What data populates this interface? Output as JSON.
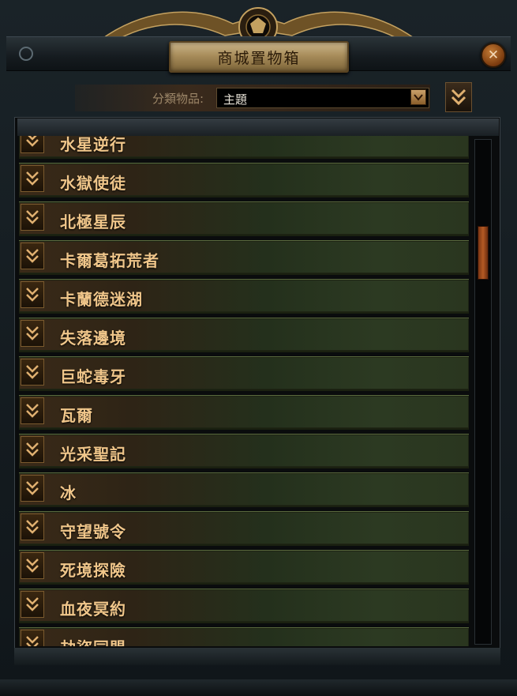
{
  "window": {
    "title": "商城置物箱",
    "close_glyph": "✕"
  },
  "filter": {
    "label": "分類物品:",
    "selected": "主題"
  },
  "items": [
    "水星逆行",
    "水獄使徒",
    "北極星辰",
    "卡爾葛拓荒者",
    "卡蘭德迷湖",
    "失落邊境",
    "巨蛇毒牙",
    "瓦爾",
    "光采聖記",
    "冰",
    "守望號令",
    "死境探險",
    "血夜冥約",
    "劫盜同盟"
  ],
  "scroll": {
    "position_fraction": 0.17
  },
  "colors": {
    "accent": "#f0c68a",
    "gold": "#a88d5b",
    "close": "#b55a24"
  },
  "icons": {
    "item": "chevron-down-icon",
    "close": "close-icon",
    "dropdown": "dropdown-caret-icon"
  }
}
